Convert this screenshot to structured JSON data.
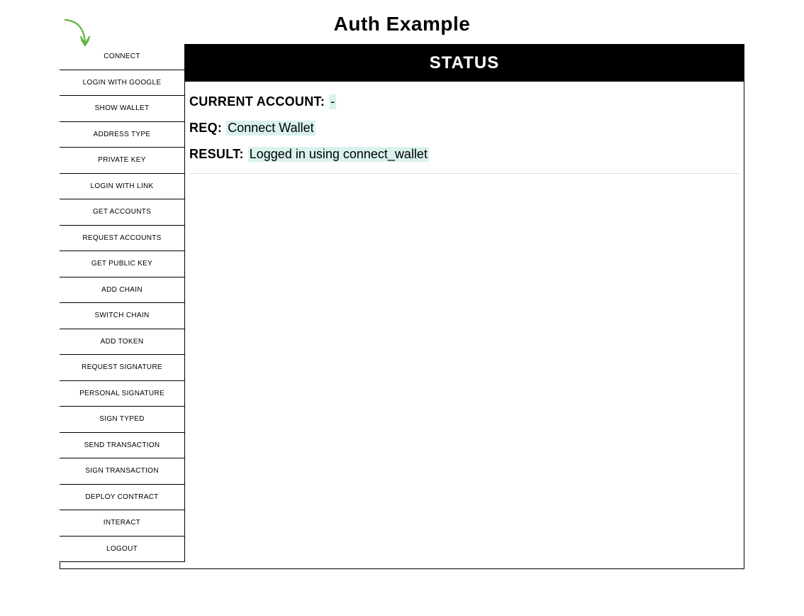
{
  "page": {
    "title": "Auth Example"
  },
  "sidebar": {
    "buttons": [
      {
        "id": "connect",
        "label": "CONNECT"
      },
      {
        "id": "login-with-google",
        "label": "LOGIN WITH GOOGLE"
      },
      {
        "id": "show-wallet",
        "label": "SHOW WALLET"
      },
      {
        "id": "address-type",
        "label": "ADDRESS TYPE"
      },
      {
        "id": "private-key",
        "label": "PRIVATE KEY"
      },
      {
        "id": "login-with-link",
        "label": "LOGIN WITH LINK"
      },
      {
        "id": "get-accounts",
        "label": "GET ACCOUNTS"
      },
      {
        "id": "request-accounts",
        "label": "REQUEST ACCOUNTS"
      },
      {
        "id": "get-public-key",
        "label": "GET PUBLIC KEY"
      },
      {
        "id": "add-chain",
        "label": "ADD CHAIN"
      },
      {
        "id": "switch-chain",
        "label": "SWITCH CHAIN"
      },
      {
        "id": "add-token",
        "label": "ADD TOKEN"
      },
      {
        "id": "request-signature",
        "label": "REQUEST SIGNATURE"
      },
      {
        "id": "personal-signature",
        "label": "PERSONAL SIGNATURE"
      },
      {
        "id": "sign-typed",
        "label": "SIGN TYPED"
      },
      {
        "id": "send-transaction",
        "label": "SEND TRANSACTION"
      },
      {
        "id": "sign-transaction",
        "label": "SIGN TRANSACTION"
      },
      {
        "id": "deploy-contract",
        "label": "DEPLOY CONTRACT"
      },
      {
        "id": "interact",
        "label": "INTERACT"
      },
      {
        "id": "logout",
        "label": "LOGOUT"
      }
    ]
  },
  "status": {
    "header": "STATUS",
    "rows": [
      {
        "label": "CURRENT ACCOUNT:",
        "value": "-"
      },
      {
        "label": "REQ:",
        "value": "Connect Wallet"
      },
      {
        "label": "RESULT:",
        "value": "Logged in using connect_wallet"
      }
    ]
  },
  "colors": {
    "highlight": "#d9f2ee",
    "arrow": "#5fb548"
  }
}
